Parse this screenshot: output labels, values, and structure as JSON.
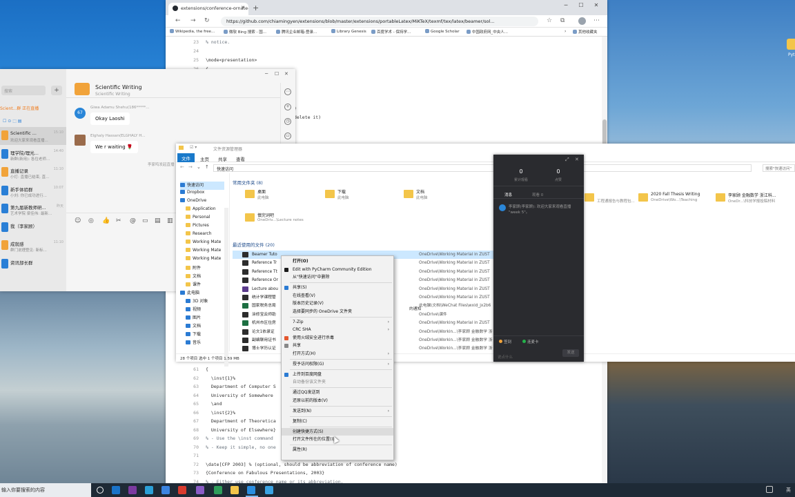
{
  "colors": {
    "accent_blue": "#1979ca",
    "selection": "#cce8ff",
    "dark_panel": "#2a2b2f",
    "wechat_badge_green": "#24b24b"
  },
  "desktop": {
    "icons": [
      {
        "name": "folder-icon",
        "label": "Pyt",
        "color": "#f3c54a"
      }
    ]
  },
  "browser": {
    "tab_title": "extensions/conference-ornate-2",
    "url": "https://github.com/chiamingyen/extensions/blob/master/extensions/portableLatex/MiKTeX/texmf/tex/latex/beamer/sol...",
    "bookmarks": [
      "Wikipedia, the free...",
      "微软 Bing 搜索 - 国...",
      "腾讯企业邮箱-登录...",
      "Library Genesis",
      "百度学术 - 保持学...",
      "Google Scholar",
      "中国政府网_中央人..."
    ],
    "bookmarks_more": "其他收藏夹",
    "code_top": [
      {
        "ln": "23",
        "text": "% notice."
      },
      {
        "ln": "24",
        "text": ""
      },
      {
        "ln": "25",
        "text": "\\mode<presentation>"
      },
      {
        "ln": "26",
        "text": "{"
      }
    ],
    "code_peek": [
      {
        "text": "}"
      },
      {
        "text": "delete it)"
      }
    ],
    "code_bottom": [
      {
        "ln": "61",
        "text": "{"
      },
      {
        "ln": "62",
        "text": "  \\inst{1}%"
      },
      {
        "ln": "63",
        "text": "  Department of Computer S"
      },
      {
        "ln": "64",
        "text": "  University of Somewhere"
      },
      {
        "ln": "65",
        "text": "  \\and"
      },
      {
        "ln": "66",
        "text": "  \\inst{2}%"
      },
      {
        "ln": "67",
        "text": "  Department of Theoretica"
      },
      {
        "ln": "68",
        "text": "  University of Elsewhere}"
      },
      {
        "ln": "69",
        "text": "% - Use the \\inst command"
      },
      {
        "ln": "70",
        "text": "% - Keep it simple, no one"
      },
      {
        "ln": "71",
        "text": ""
      },
      {
        "ln": "72",
        "text": "\\date[CFP 2003] % (optional, should be abbreviation of conference name)"
      },
      {
        "ln": "73",
        "text": "{Conference on Fabulous Presentations, 2003}"
      },
      {
        "ln": "74",
        "text": "% - Either use conference name or its abbreviation."
      }
    ]
  },
  "wechat": {
    "search_placeholder": "搜索",
    "group_title": "Scientific Writing",
    "group_subtitle": "Scientific Writing",
    "live_banner": "Scient...群 正在直播",
    "chats": [
      {
        "name": "Scientific ...",
        "msg": "欢迎大家来观看直播...",
        "time": "15:10",
        "color": "#f1a33a"
      },
      {
        "name": "理学院/理光...",
        "msg": "新群(新用): 各位老师...",
        "time": "14:40",
        "color": "#2a7fd6"
      },
      {
        "name": "直播记录",
        "msg": "小灯: 直播已结束, 直...",
        "time": "11:10",
        "color": "#f1a33a"
      },
      {
        "name": "新手体验群",
        "msg": "小刘: 你已成功进行...",
        "time": "10:07",
        "color": "#2a7fd6"
      },
      {
        "name": "第九届新教师研...",
        "msg": "艺术学院 梁佳伟: 最新...",
        "time": "昨天",
        "color": "#2a7fd6"
      },
      {
        "name": "我（李家顾）",
        "msg": "",
        "time": "",
        "color": "#2a7fd6"
      },
      {
        "name": "成就感",
        "msg": "群门说理登见: 新标...",
        "time": "11:10",
        "color": "#f1a33a"
      },
      {
        "name": "资讯部长群",
        "msg": "",
        "time": "",
        "color": "#2a7fd6"
      }
    ],
    "messages": [
      {
        "sender": "Giwa Adamu Shehu(186*****...",
        "text": "Okay Laoshi",
        "avatar_text": "67",
        "avatar_color": "#2a86d8"
      },
      {
        "sender": "Elghaly Hassan(ELGHALY H...",
        "text": "We r waiting 🌹",
        "avatar_text": "",
        "avatar_color": "#9a6b4b"
      }
    ],
    "system_note": "李家鸣发起直播"
  },
  "explorer": {
    "title": "文件资源管理器",
    "ribbon_tabs": [
      "文件",
      "主页",
      "共享",
      "查看"
    ],
    "path": "快速访问",
    "search_placeholder": "搜索\"快速访问\"",
    "nav": [
      {
        "label": "快速访问",
        "type": "b"
      },
      {
        "label": "Dropbox",
        "type": "b"
      },
      {
        "label": "OneDrive",
        "type": "b"
      },
      {
        "label": "Application",
        "type": "f"
      },
      {
        "label": "Personal",
        "type": "f"
      },
      {
        "label": "Pictures",
        "type": "f"
      },
      {
        "label": "Research",
        "type": "f"
      },
      {
        "label": "Working Mate",
        "type": "f"
      },
      {
        "label": "Working Mate",
        "type": "f"
      },
      {
        "label": "Working Mate",
        "type": "f"
      },
      {
        "label": "附件",
        "type": "f"
      },
      {
        "label": "文档",
        "type": "f"
      },
      {
        "label": "课件",
        "type": "f"
      },
      {
        "label": "此电脑",
        "type": "b"
      },
      {
        "label": "3D 对象",
        "type": "b"
      },
      {
        "label": "视频",
        "type": "b"
      },
      {
        "label": "图片",
        "type": "b"
      },
      {
        "label": "文档",
        "type": "b"
      },
      {
        "label": "下载",
        "type": "b"
      },
      {
        "label": "音乐",
        "type": "b"
      }
    ],
    "quick_access_title": "常用文件夹 (8)",
    "quick_access": [
      {
        "name": "桌面",
        "sub": "此电脑"
      },
      {
        "name": "下载",
        "sub": "此电脑"
      },
      {
        "name": "文档",
        "sub": "此电脑"
      },
      {
        "name": "慎完词吧",
        "sub": "OneDriv...\\Lecture notes"
      }
    ],
    "quick_access_right": [
      {
        "name": "",
        "sub": "工程通报告与教程包..."
      },
      {
        "name": "2020 Fall Thesis Writing",
        "sub": "OneDrive\\Wo...\\Teaching"
      },
      {
        "name": "李家顾 金融数学 浙江科...",
        "sub": "OneDr...\\科技学报投稿材料"
      }
    ],
    "recent_title": "最近使用的文件 (20)",
    "recent": [
      {
        "name": "Beamer Tuto",
        "path": "OneDrive\\Working Material in ZUST",
        "color": "#2d2d2d"
      },
      {
        "name": "Reference Tr",
        "path": "OneDrive\\Working Material in ZUST",
        "color": "#2d2d2d"
      },
      {
        "name": "Reference Tt",
        "path": "OneDrive\\Working Material in ZUST",
        "color": "#2d2d2d"
      },
      {
        "name": "Reference Or",
        "path": "OneDrive\\Working Material in ZUST",
        "color": "#2d2d2d"
      },
      {
        "name": "Lecture abou",
        "path": "OneDrive\\Working Material in ZUST",
        "color": "#5b3b8c"
      },
      {
        "name": "统计学课程管",
        "path": "OneDrive\\Working Material in ZUST",
        "color": "#2d2d2d"
      },
      {
        "name": "国家税务总局",
        "path": "此电脑\\文档\\WeChat Files\\wxid_jx2b6",
        "color": "#1d6f42"
      },
      {
        "name": "涂修宝云师助",
        "path": "OneDrive\\课件",
        "color": "#2d2d2d"
      },
      {
        "name": "机州市区住房",
        "path": "OneDrive\\Working Material in ZUST",
        "color": "#1d6f42"
      },
      {
        "name": "论文1依录证",
        "path": "OneDrive\\Workin...\\李家顾 金融数学 浙",
        "color": "#2d2d2d"
      },
      {
        "name": "副编聊用证书",
        "path": "OneDrive\\Workin...\\李家顾 金融数学 浙",
        "color": "#2d2d2d"
      },
      {
        "name": "博士学历认证",
        "path": "OneDrive\\Workin...\\李家顾 金融数学 浙",
        "color": "#2d2d2d"
      }
    ],
    "extra_text": "的通知",
    "status": "28 个项目    选中 1 个项目  1.59 MB"
  },
  "live": {
    "stat1_num": "0",
    "stat1_label": "累计观看",
    "stat2_num": "0",
    "stat2_label": "点赞",
    "tabs": [
      "消息",
      "观看 0"
    ],
    "message": "李家顾(李家顾): 欢迎大家来观看直播 \"week 5\"。",
    "foot_left": "签到",
    "foot_right": "连麦卡",
    "input_placeholder": "说点什么",
    "send": "发送"
  },
  "context_menu": {
    "items": [
      {
        "label": "打开(O)",
        "bold": true,
        "sep_after": false,
        "arrow": false,
        "icon": ""
      },
      {
        "label": "Edit with PyCharm Community Edition",
        "sep_after": false,
        "arrow": false,
        "icon": "#1a1a1a"
      },
      {
        "label": "从\"快速访问\"中删除",
        "sep_after": true,
        "arrow": false,
        "icon": ""
      },
      {
        "label": "共享(S)",
        "sep_after": false,
        "arrow": false,
        "icon": "#2b7bd3"
      },
      {
        "label": "在线查看(V)",
        "sep_after": false,
        "arrow": false,
        "icon": ""
      },
      {
        "label": "版本历史记录(V)",
        "sep_after": false,
        "arrow": false,
        "icon": ""
      },
      {
        "label": "选择要同步的 OneDrive 文件夹",
        "sep_after": true,
        "arrow": false,
        "icon": ""
      },
      {
        "label": "7-Zip",
        "sep_after": false,
        "arrow": true,
        "icon": ""
      },
      {
        "label": "CRC SHA",
        "sep_after": false,
        "arrow": true,
        "icon": ""
      },
      {
        "label": "使用火绒安全进行杀毒",
        "sep_after": false,
        "arrow": false,
        "icon": "#e4572e"
      },
      {
        "label": "共享",
        "sep_after": false,
        "arrow": false,
        "icon": "#888"
      },
      {
        "label": "打开方式(H)",
        "sep_after": true,
        "arrow": true,
        "icon": ""
      },
      {
        "label": "授予访问权限(G)",
        "sep_after": true,
        "arrow": true,
        "icon": ""
      },
      {
        "label": "上传到百度网盘",
        "sep_after": false,
        "arrow": false,
        "icon": "#2b7bd3"
      },
      {
        "label": "自动备份该文件夹",
        "dim": true,
        "sep_after": true,
        "arrow": false,
        "icon": ""
      },
      {
        "label": "通过QQ发送到",
        "sep_after": false,
        "arrow": false,
        "icon": ""
      },
      {
        "label": "还原以前的版本(V)",
        "sep_after": true,
        "arrow": false,
        "icon": ""
      },
      {
        "label": "发送到(N)",
        "sep_after": true,
        "arrow": true,
        "icon": ""
      },
      {
        "label": "复制(C)",
        "sep_after": true,
        "arrow": false,
        "icon": ""
      },
      {
        "label": "创建快捷方式(S)",
        "hover": true,
        "sep_after": false,
        "arrow": false,
        "icon": ""
      },
      {
        "label": "打开文件所在的位置(I)",
        "sep_after": true,
        "arrow": false,
        "icon": ""
      },
      {
        "label": "属性(R)",
        "sep_after": false,
        "arrow": false,
        "icon": ""
      }
    ]
  },
  "taskbar": {
    "search": "输入你要搜索的内容",
    "apps": [
      {
        "name": "search-circle-icon",
        "color": "#ffffff"
      },
      {
        "name": "outlook-icon",
        "color": "#1a73c8"
      },
      {
        "name": "onenote-icon",
        "color": "#7b3aa0"
      },
      {
        "name": "edge-icon",
        "color": "#2ba0d8"
      },
      {
        "name": "todo-icon",
        "color": "#3b84e0"
      },
      {
        "name": "pdf-icon",
        "color": "#d93b2e"
      },
      {
        "name": "app-icon",
        "color": "#8a5cc6"
      },
      {
        "name": "app-green-icon",
        "color": "#2e9e5b"
      },
      {
        "name": "explorer-icon",
        "color": "#f3c54a"
      },
      {
        "name": "dingtalk-icon",
        "color": "#2a8de0"
      },
      {
        "name": "app-blue-icon",
        "color": "#3aa3e3"
      }
    ],
    "tray": "英"
  }
}
